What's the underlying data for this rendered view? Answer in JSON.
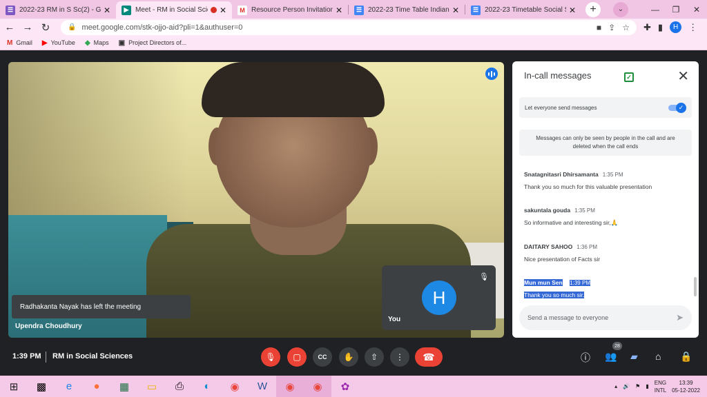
{
  "browser": {
    "tabs": [
      {
        "title": "2022-23 RM in S Sc(2) - Google",
        "favicon": "sheets-icon",
        "color": "#7e57c2",
        "active": false,
        "recording": false
      },
      {
        "title": "Meet - RM in Social Science",
        "favicon": "meet-icon",
        "color": "#00897b",
        "active": true,
        "recording": true
      },
      {
        "title": "Resource Person Invitation: Re",
        "favicon": "gmail-icon",
        "color": "#d93025",
        "active": false,
        "recording": false
      },
      {
        "title": "2022-23 Time Table Indian Lan",
        "favicon": "docs-icon",
        "color": "#4285f4",
        "active": false,
        "recording": false
      },
      {
        "title": "2022-23 Timetable Social Scie",
        "favicon": "docs-icon",
        "color": "#4285f4",
        "active": false,
        "recording": false
      }
    ],
    "new_tab": "+",
    "url": "meet.google.com/stk-ojjo-aid?pli=1&authuser=0",
    "profile_initial": "H",
    "bookmarks": [
      {
        "label": "Gmail",
        "icon": "M",
        "color": "#d93025"
      },
      {
        "label": "YouTube",
        "icon": "▶",
        "color": "#ff0000"
      },
      {
        "label": "Maps",
        "icon": "◆",
        "color": "#34a853"
      },
      {
        "label": "Project Directors of...",
        "icon": "▣",
        "color": "#222222"
      }
    ]
  },
  "meet": {
    "toast": "Radhakanta Nayak has left the meeting",
    "speaker": "Upendra Choudhury",
    "self_initial": "H",
    "self_label": "You",
    "time": "1:39 PM",
    "meeting_name": "RM in Social Sciences",
    "participants_count": "28"
  },
  "chat": {
    "title": "In-call messages",
    "setting_label": "Let everyone send messages",
    "setting_on": true,
    "notice": "Messages can only be seen by people in the call and are deleted when the call ends",
    "messages": [
      {
        "sender": "Snatagnitasri Dhirsamanta",
        "time": "1:35 PM",
        "text": "Thank you so much for this valuable presentation"
      },
      {
        "sender": "sakuntala gouda",
        "time": "1:35 PM",
        "text": "So informative and interesting sir,🙏"
      },
      {
        "sender": "DAITARY SAHOO",
        "time": "1:36 PM",
        "text": "Nice presentation of Facts sir"
      },
      {
        "sender": "Mun mun Sen",
        "time": "1:39 PM",
        "text": "Thank you so much sir."
      }
    ],
    "compose_placeholder": "Send a message to everyone"
  },
  "taskbar": {
    "lang_top": "ENG",
    "lang_bottom": "INTL",
    "clock_time": "13:39",
    "clock_date": "05-12-2022"
  }
}
